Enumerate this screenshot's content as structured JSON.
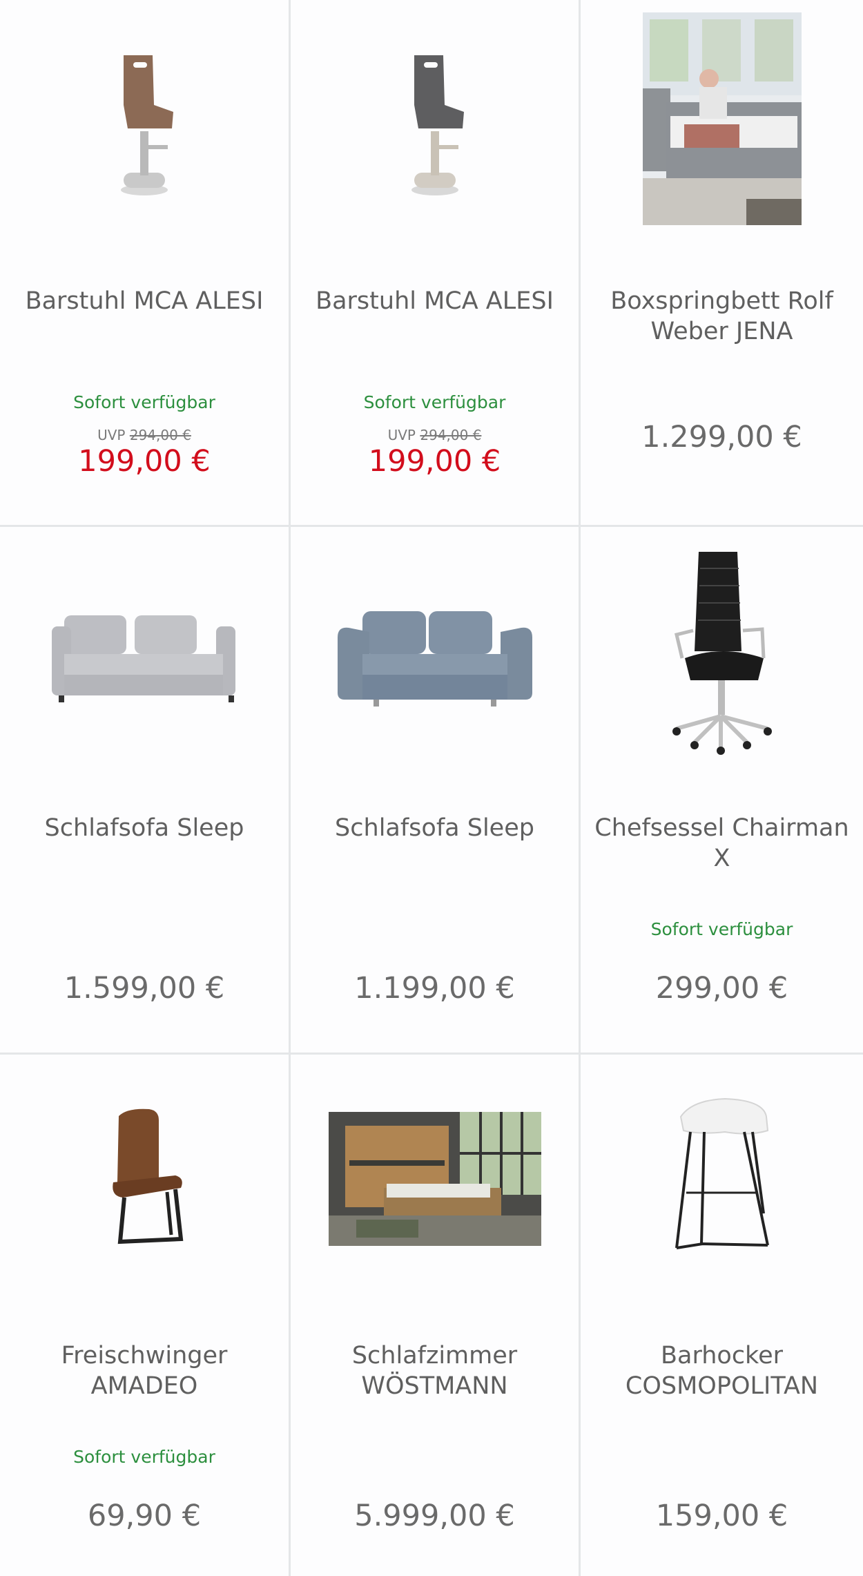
{
  "products": [
    {
      "name": "Barstuhl MCA ALESI",
      "availability": "Sofort verfügbar",
      "uvp_label": "UVP",
      "uvp_price": "294,00 €",
      "price": "199,00 €",
      "icon": "bar-stool-brown-image"
    },
    {
      "name": "Barstuhl MCA ALESI",
      "availability": "Sofort verfügbar",
      "uvp_label": "UVP",
      "uvp_price": "294,00 €",
      "price": "199,00 €",
      "icon": "bar-stool-grey-image"
    },
    {
      "name": "Boxspringbett Rolf Weber JENA",
      "price": "1.299,00 €",
      "icon": "boxspring-bed-photo"
    },
    {
      "name": "Schlafsofa Sleep",
      "price": "1.599,00 €",
      "icon": "sofa-light-grey-image"
    },
    {
      "name": "Schlafsofa Sleep",
      "price": "1.199,00 €",
      "icon": "sofa-blue-grey-image"
    },
    {
      "name": "Chefsessel Chairman X",
      "availability": "Sofort verfügbar",
      "price": "299,00 €",
      "icon": "office-chair-image"
    },
    {
      "name": "Freischwinger AMADEO",
      "availability": "Sofort verfügbar",
      "price": "69,90 €",
      "icon": "cantilever-chair-image"
    },
    {
      "name": "Schlafzimmer WÖSTMANN",
      "price": "5.999,00 €",
      "icon": "bedroom-set-photo"
    },
    {
      "name": "Barhocker COSMOPOLITAN",
      "price": "159,00 €",
      "icon": "white-bar-stool-image"
    }
  ],
  "colors": {
    "sale_price": "#d20d1c",
    "availability": "#2c8f3e",
    "text": "#5f5f5f",
    "divider": "#e4e6e8"
  }
}
